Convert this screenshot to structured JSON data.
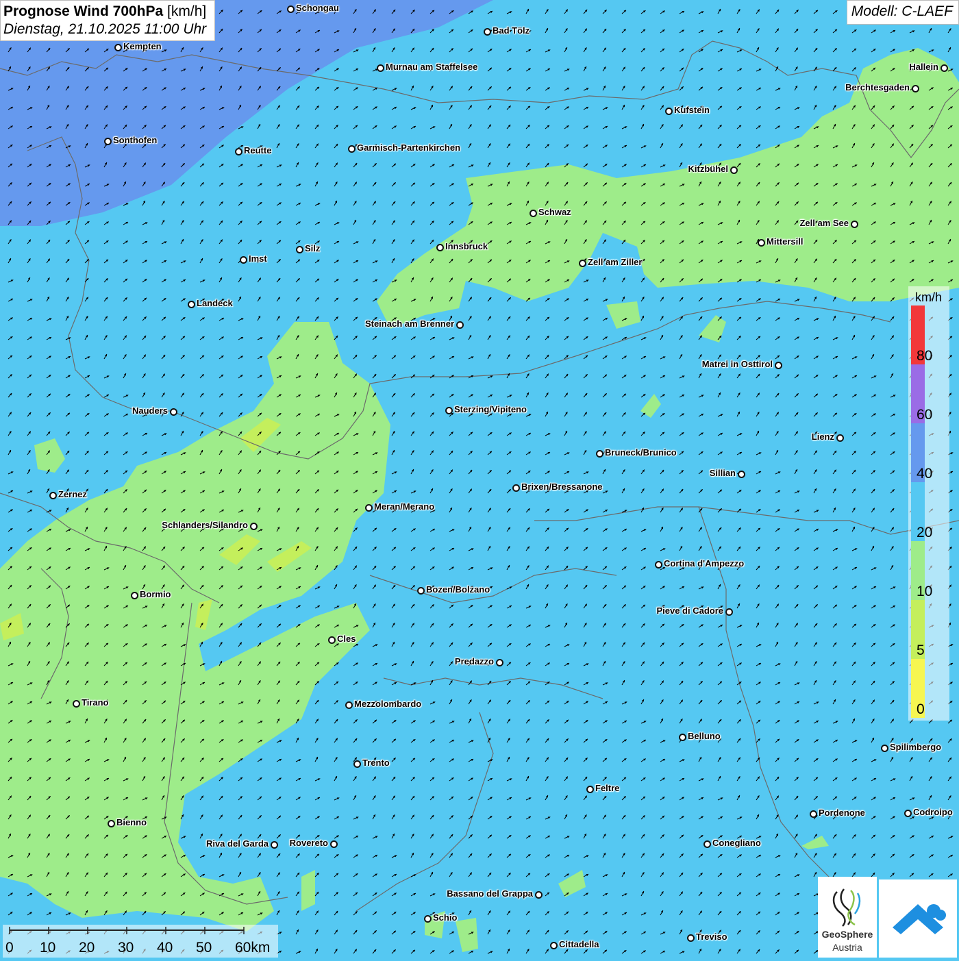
{
  "title": {
    "main": "Prognose Wind 700hPa",
    "unit": "[km/h]",
    "date": "Dienstag, 21.10.2025 11:00 Uhr"
  },
  "model": "Modell: C-LAEF",
  "colors": {
    "cat_0_5": "#f6f651",
    "cat_5_10": "#c4ef5c",
    "cat_10_20": "#9eec8a",
    "cat_20_40": "#55c8f2",
    "cat_40_60": "#6599ee",
    "cat_60_80": "#9a6ce6",
    "cat_80": "#f2383a",
    "wind_arrow": "#000000"
  },
  "legend": {
    "unit": "km/h",
    "ticks": [
      "80",
      "60",
      "40",
      "20",
      "10",
      "5",
      "0"
    ]
  },
  "scale_bar": {
    "labels": [
      "0",
      "10",
      "20",
      "30",
      "40",
      "50",
      "60km"
    ]
  },
  "cities": [
    {
      "name": "Schongau"
    },
    {
      "name": "Bad Tölz"
    },
    {
      "name": "Kempten"
    },
    {
      "name": "Murnau am Staffelsee"
    },
    {
      "name": "Hallein"
    },
    {
      "name": "Berchtesgaden"
    },
    {
      "name": "Kufstein"
    },
    {
      "name": "Sonthofen"
    },
    {
      "name": "Reutte"
    },
    {
      "name": "Garmisch-Partenkirchen"
    },
    {
      "name": "Kitzbühel"
    },
    {
      "name": "Schwaz"
    },
    {
      "name": "Zell am See"
    },
    {
      "name": "Innsbruck"
    },
    {
      "name": "Mittersill"
    },
    {
      "name": "Imst"
    },
    {
      "name": "Silz"
    },
    {
      "name": "Zell am Ziller"
    },
    {
      "name": "Landeck"
    },
    {
      "name": "Steinach am Brenner"
    },
    {
      "name": "Matrei in Osttirol"
    },
    {
      "name": "Nauders"
    },
    {
      "name": "Sterzing/Vipiteno"
    },
    {
      "name": "Lienz"
    },
    {
      "name": "Bruneck/Brunico"
    },
    {
      "name": "Sillian"
    },
    {
      "name": "Zernez"
    },
    {
      "name": "Brixen/Bressanone"
    },
    {
      "name": "Meran/Merano"
    },
    {
      "name": "Schlanders/Silandro"
    },
    {
      "name": "Cortina d'Ampezzo"
    },
    {
      "name": "Bozen/Bolzano"
    },
    {
      "name": "Bormio"
    },
    {
      "name": "Pieve di Cadore"
    },
    {
      "name": "Cles"
    },
    {
      "name": "Predazzo"
    },
    {
      "name": "Tirano"
    },
    {
      "name": "Mezzolombardo"
    },
    {
      "name": "Belluno"
    },
    {
      "name": "Spilimbergo"
    },
    {
      "name": "Trento"
    },
    {
      "name": "Feltre"
    },
    {
      "name": "Pordenone"
    },
    {
      "name": "Codroipo"
    },
    {
      "name": "Bienno"
    },
    {
      "name": "Riva del Garda"
    },
    {
      "name": "Rovereto"
    },
    {
      "name": "Conegliano"
    },
    {
      "name": "Bassano del Grappa"
    },
    {
      "name": "Schio"
    },
    {
      "name": "Treviso"
    },
    {
      "name": "Cittadella"
    }
  ],
  "logos": {
    "geosphere_line1": "GeoSphere",
    "geosphere_line2": "Austria"
  }
}
